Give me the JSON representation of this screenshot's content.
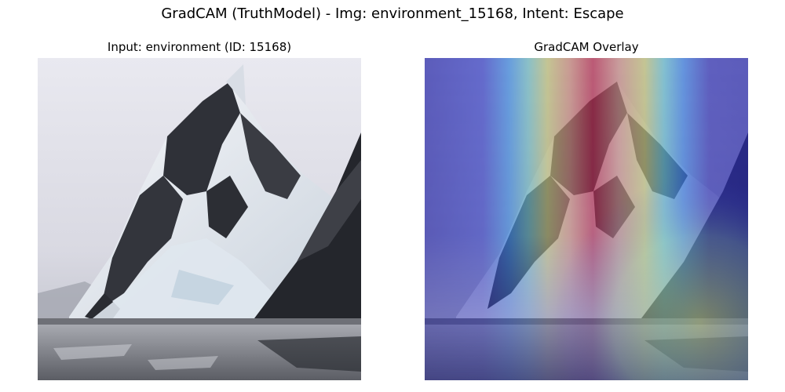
{
  "figure": {
    "title": "GradCAM (TruthModel) - Img: environment_15168, Intent: Escape"
  },
  "panels": [
    {
      "title": "Input: environment (ID: 15168)",
      "kind": "input-photo"
    },
    {
      "title": "GradCAM Overlay",
      "kind": "gradcam-overlay",
      "colormap": "jet"
    }
  ],
  "colors": {
    "sky": "#dcdde6",
    "snow": "#eef1f4",
    "rock": "#2b2d33",
    "water": "#8a8e95",
    "heat_high": "#d22020",
    "heat_low": "#2020b0"
  }
}
